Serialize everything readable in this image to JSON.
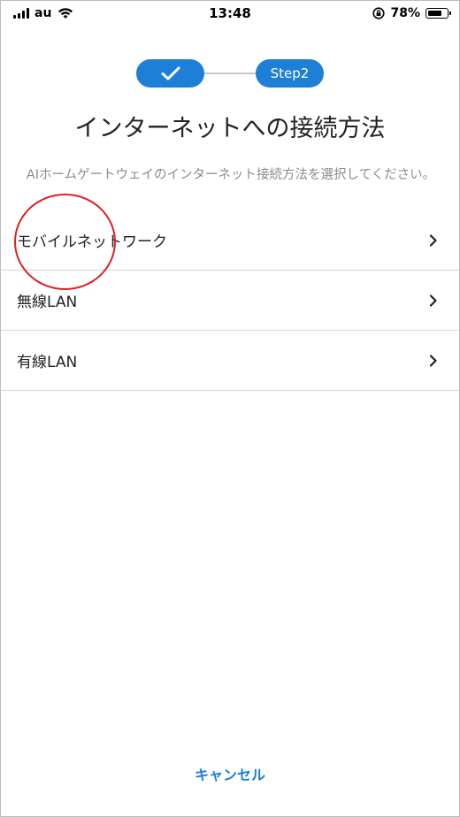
{
  "status_bar": {
    "carrier": "au",
    "time": "13:48",
    "battery_percent": "78%",
    "battery_level": 0.78
  },
  "stepper": {
    "step1_state": "completed",
    "step2_label": "Step2"
  },
  "title": "インターネットへの接続方法",
  "description": "AIホームゲートウェイのインターネット接続方法を選択してください。",
  "options": [
    {
      "label": "モバイルネットワーク"
    },
    {
      "label": "無線LAN"
    },
    {
      "label": "有線LAN"
    }
  ],
  "cancel_label": "キャンセル",
  "colors": {
    "accent": "#1e7fd6",
    "highlight": "#e02020"
  }
}
